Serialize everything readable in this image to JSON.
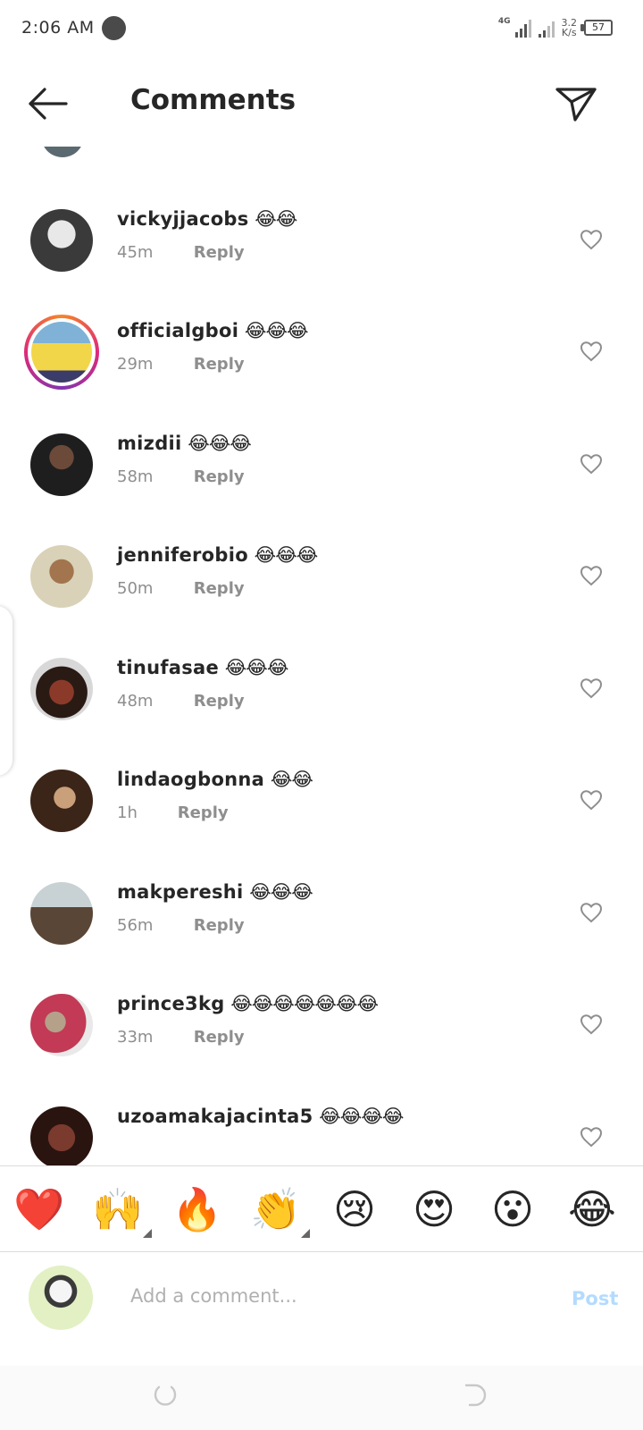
{
  "status_bar": {
    "time": "2:06 AM",
    "network": "4G",
    "speed_value": "3.2",
    "speed_unit": "K/s",
    "battery": "57"
  },
  "header": {
    "title": "Comments",
    "back_icon": "arrow-left-icon",
    "share_icon": "send-icon"
  },
  "comments": [
    {
      "username": "vickyjjacobs",
      "emoji": "😂😂",
      "time": "45m",
      "reply": "Reply",
      "has_story": false
    },
    {
      "username": "officialgboi",
      "emoji": "😂😂😂",
      "time": "29m",
      "reply": "Reply",
      "has_story": true
    },
    {
      "username": "mizdii",
      "emoji": "😂😂😂",
      "time": "58m",
      "reply": "Reply",
      "has_story": false
    },
    {
      "username": "jenniferobio",
      "emoji": "😂😂😂",
      "time": "50m",
      "reply": "Reply",
      "has_story": false
    },
    {
      "username": "tinufasae",
      "emoji": "😂😂😂",
      "time": "48m",
      "reply": "Reply",
      "has_story": false
    },
    {
      "username": "lindaogbonna",
      "emoji": "😂😂",
      "time": "1h",
      "reply": "Reply",
      "has_story": false
    },
    {
      "username": "makpereshi",
      "emoji": "😂😂😂",
      "time": "56m",
      "reply": "Reply",
      "has_story": false
    },
    {
      "username": "prince3kg",
      "emoji": "😂😂😂😂😂😂😂",
      "time": "33m",
      "reply": "Reply",
      "has_story": false
    },
    {
      "username": "uzoamakajacinta5",
      "emoji": "😂😂😂😂",
      "time": "",
      "reply": "",
      "has_story": false
    }
  ],
  "emoji_bar": [
    {
      "glyph": "❤️",
      "name": "red-heart"
    },
    {
      "glyph": "🙌",
      "name": "raising-hands"
    },
    {
      "glyph": "🔥",
      "name": "fire"
    },
    {
      "glyph": "👏",
      "name": "clapping-hands"
    },
    {
      "glyph": "😢",
      "name": "crying-face"
    },
    {
      "glyph": "😍",
      "name": "heart-eyes"
    },
    {
      "glyph": "😮",
      "name": "open-mouth"
    },
    {
      "glyph": "😂",
      "name": "tears-of-joy"
    }
  ],
  "composer": {
    "placeholder": "Add a comment...",
    "post_label": "Post"
  },
  "colors": {
    "text": "#262626",
    "secondary": "#8e8e8e",
    "post_disabled": "#b3dbff",
    "divider": "#dbdbdb"
  }
}
